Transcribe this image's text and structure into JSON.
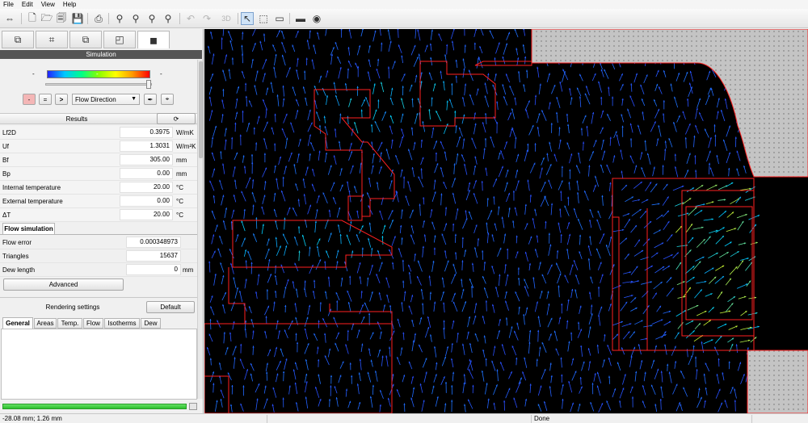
{
  "menu": [
    "File",
    "Edit",
    "View",
    "Help"
  ],
  "toolbar": {
    "mode_3d": "3D",
    "icons": [
      "swap-icon",
      "new-file-icon",
      "open-folder-icon",
      "open-file-icon",
      "save-icon",
      "print-icon",
      "zoom-in-icon",
      "zoom-out-icon",
      "zoom-fit-icon",
      "zoom-window-icon",
      "undo-icon",
      "redo-icon",
      "3d-view-icon",
      "select-cursor-icon",
      "select-window-icon",
      "measure-ruler-icon",
      "comment-icon",
      "view-eye-icon"
    ]
  },
  "left_tabs": [
    "geometry-tab-icon",
    "grid-tab-icon",
    "boundary-tab-icon",
    "materials-tab-icon",
    "simulation-tab-icon"
  ],
  "simulation": {
    "header": "Simulation",
    "colorbar_min": "-",
    "colorbar_max": "-",
    "colorbar_mid": "-",
    "slider_fraction": 0.97,
    "display_mode": "Flow Direction",
    "buttons": {
      "minus": "-",
      "equal": "=",
      "next": ">"
    }
  },
  "results": {
    "title": "Results",
    "rows": [
      {
        "label": "Lf2D",
        "value": "0.3975",
        "unit": "W/mK"
      },
      {
        "label": "Uf",
        "value": "1.3031",
        "unit": "W/m²K"
      },
      {
        "label": "Bf",
        "value": "305.00",
        "unit": "mm"
      },
      {
        "label": "Bp",
        "value": "0.00",
        "unit": "mm"
      },
      {
        "label": "Internal temperature",
        "value": "20.00",
        "unit": "°C"
      },
      {
        "label": "External temperature",
        "value": "0.00",
        "unit": "°C"
      },
      {
        "label": "ΔT",
        "value": "20.00",
        "unit": "°C"
      }
    ]
  },
  "flow": {
    "tab": "Flow simulation",
    "rows": [
      {
        "label": "Flow error",
        "value": "0.000348973",
        "unit": ""
      },
      {
        "label": "Triangles",
        "value": "15637",
        "unit": ""
      },
      {
        "label": "Dew length",
        "value": "0",
        "unit": "mm"
      }
    ],
    "advanced_button": "Advanced"
  },
  "rendering": {
    "title": "Rendering settings",
    "default_button": "Default",
    "tabs": [
      "General",
      "Areas",
      "Temp.",
      "Flow",
      "Isotherms",
      "Dew"
    ],
    "selected_tab": "General"
  },
  "progress_fraction": 1.0,
  "status": {
    "coordinates": "-28.08 mm; 1.26 mm",
    "state": "Done"
  },
  "colors": {
    "background": "#000000",
    "outline": "#ff2020",
    "arrow_low": "#2a4dff",
    "arrow_mid": "#00d0ff",
    "arrow_high": "#ffff00",
    "progress": "#3ccc3c",
    "wall": "#c0c0c0"
  }
}
